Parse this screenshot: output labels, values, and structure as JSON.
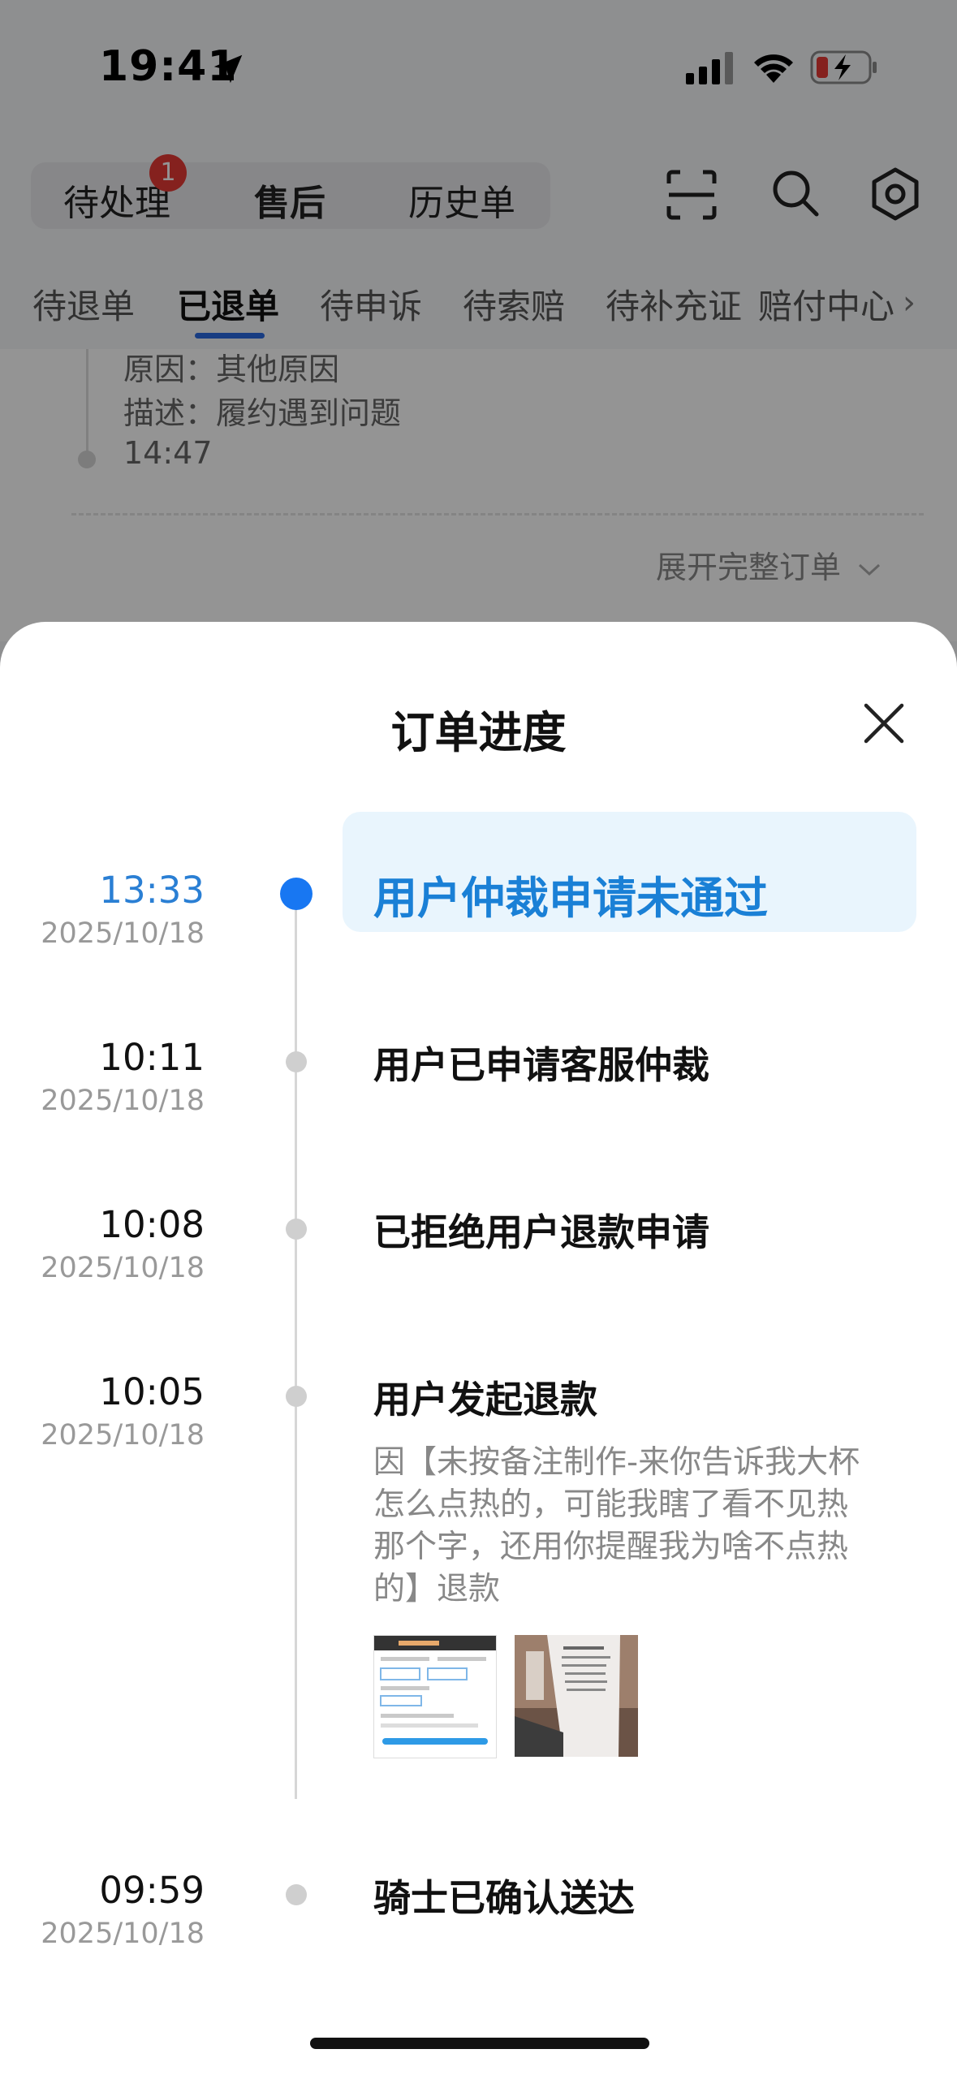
{
  "status_bar": {
    "time": "19:41"
  },
  "top_tabs": {
    "pending": "待处理",
    "pending_badge": "1",
    "aftersale": "售后",
    "history": "历史单"
  },
  "sub_tabs": [
    "待退单",
    "已退单",
    "待申诉",
    "待索赔",
    "待补充证",
    "赔付中心"
  ],
  "bg_card": {
    "reason": "原因：其他原因",
    "description": "描述：履约遇到问题",
    "time": "14:47",
    "expand": "展开完整订单"
  },
  "sheet": {
    "title": "订单进度",
    "steps": [
      {
        "time": "13:33",
        "date": "2025/10/18",
        "title": "用户仲裁申请未通过",
        "active": true
      },
      {
        "time": "10:11",
        "date": "2025/10/18",
        "title": "用户已申请客服仲裁"
      },
      {
        "time": "10:08",
        "date": "2025/10/18",
        "title": "已拒绝用户退款申请"
      },
      {
        "time": "10:05",
        "date": "2025/10/18",
        "title": "用户发起退款",
        "desc_lines": [
          "因【未按备注制作-来你告诉我大杯",
          "怎么点热的，可能我瞎了看不见热",
          "那个字，还用你提醒我为啥不点热",
          "的】退款"
        ]
      },
      {
        "time": "09:59",
        "date": "2025/10/18",
        "title": "骑士已确认送达"
      }
    ]
  },
  "colors": {
    "accent": "#1877f2",
    "active_text": "#1a80d6",
    "active_bg": "#e9f5fd",
    "badge": "#e53935"
  }
}
